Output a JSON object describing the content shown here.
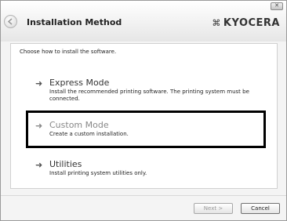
{
  "window": {
    "title": "Installation Method",
    "brand_logo": "KYOCERA",
    "close_label": "✕"
  },
  "instruction": "Choose how to install the software.",
  "options": [
    {
      "title": "Express Mode",
      "description": "Install the recommended printing software. The printing system must be connected.",
      "icon": "arrow-right-icon"
    },
    {
      "title": "Custom Mode",
      "description": "Create a custom installation.",
      "icon": "arrow-right-icon",
      "highlighted": true
    },
    {
      "title": "Utilities",
      "description": "Install printing system utilities only.",
      "icon": "arrow-right-icon"
    }
  ],
  "buttons": {
    "next": "Next >",
    "cancel": "Cancel"
  }
}
